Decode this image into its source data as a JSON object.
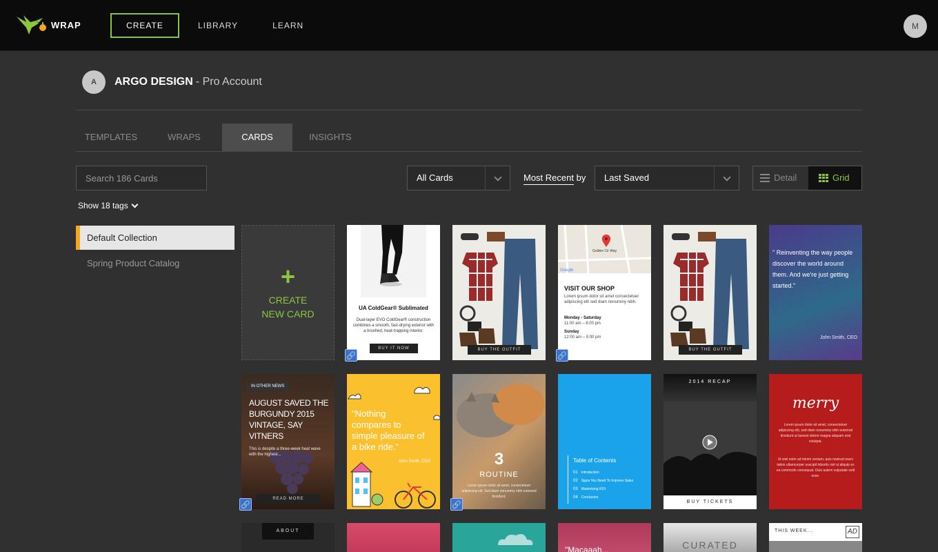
{
  "app": {
    "name": "WRAP"
  },
  "nav": {
    "items": [
      {
        "label": "CREATE"
      },
      {
        "label": "LIBRARY"
      },
      {
        "label": "LEARN"
      }
    ],
    "user_initial": "M"
  },
  "account": {
    "initial": "A",
    "name": "ARGO DESIGN",
    "type": "- Pro Account"
  },
  "tabs": [
    {
      "label": "TEMPLATES"
    },
    {
      "label": "WRAPS"
    },
    {
      "label": "CARDS"
    },
    {
      "label": "INSIGHTS"
    }
  ],
  "toolbar": {
    "search_placeholder": "Search 186 Cards",
    "filter_value": "All Cards",
    "sort_prefix": "Most Recent",
    "sort_by": "by",
    "sort_value": "Last Saved",
    "view_detail": "Detail",
    "view_grid": "Grid",
    "tags_toggle": "Show 18 tags"
  },
  "collections": [
    {
      "label": "Default Collection"
    },
    {
      "label": "Spring Product Catalog"
    }
  ],
  "create_card": {
    "plus": "+",
    "label": "CREATE NEW CARD"
  },
  "cards": {
    "c1": {
      "title": "UA ColdGear® Sublimated",
      "body": "Dual-layer EVO ColdGear® construction combines a smooth, fast-drying exterior with a brushed, heat-trapping interior.",
      "button": "BUY IT NOW"
    },
    "c2": {
      "button": "BUY THE OUTFIT"
    },
    "c3": {
      "map_label": "Golden Cir Way",
      "title": "VISIT OUR SHOP",
      "body": "Lorem ipsum dolor sit amet consectetuer adipiscing elit sed diam nonummy nibh.",
      "hours1_label": "Monday - Saturday",
      "hours1": "11:00 am – 6:00 pm",
      "hours2_label": "Sunday",
      "hours2": "12:00 am – 5:00 pm"
    },
    "c4": {
      "button": "BUY THE OUTFIT"
    },
    "c5": {
      "quote": "\" Reinventing the way people discover the world around them. And we're just getting started.\"",
      "author": "John Smith, CEO"
    },
    "c6": {
      "tag": "IN OTHER NEWS",
      "headline": "AUGUST SAVED THE BURGUNDY 2015 VINTAGE, SAY VITNERS",
      "body": "This is despite a three-week heat wave with the highest...",
      "button": "READ MORE"
    },
    "c7": {
      "quote": "\"Nothing compares to simple pleasure of a bike ride.\"",
      "author": "John Smith, CEO"
    },
    "c8": {
      "number": "3",
      "title": "ROUTINE",
      "body": "Lorem ipsum dolor sit amet, consectetuer adipiscing elit. Sed diam nonummy nibh euismod tincidunt."
    },
    "c9": {
      "title": "Table of Contents",
      "items": [
        {
          "n": "01",
          "t": "Introduction"
        },
        {
          "n": "02",
          "t": "Signs You Need To Improve Sales"
        },
        {
          "n": "03",
          "t": "Maximizing ROI"
        },
        {
          "n": "04",
          "t": "Conclusion"
        }
      ]
    },
    "c10": {
      "tag": "2014 RECAP",
      "button": "BUY TICKETS"
    },
    "c11": {
      "title": "merry",
      "body": "Lorem ipsum dolor sit amet, consectetuer adipiscing elit, sed diam nonummy nibh euismod tincidunt ut laoreet dolore magna aliquam erat volutpat.",
      "body2": "Ut wisi enim ad minim veniam, quis nostrud exerc tation ullamcorper suscipit lobortis nisl ut aliquip ex ea commodo consequat. Duis autem vulputate velit esse."
    },
    "r3a": {
      "label": "ABOUT"
    },
    "r3d": {
      "label": "\"Macaaah..."
    },
    "r3e": {
      "label": "CURATED"
    },
    "r3f": {
      "label": "THIS WEEK...",
      "badge": "AD"
    }
  },
  "colors": {
    "accent": "#8cc63f",
    "collection_marker": "#f5a623",
    "link_badge": "#3b6fd3"
  }
}
